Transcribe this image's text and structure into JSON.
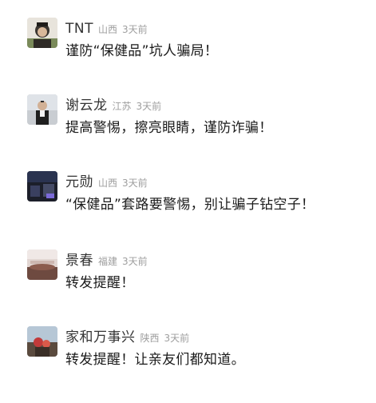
{
  "comments": [
    {
      "username": "TNT",
      "location": "山西",
      "time": "3天前",
      "text": "谨防“保健品”坑人骗局！",
      "avatar_icon": "user-avatar-icon"
    },
    {
      "username": "谢云龙",
      "location": "江苏",
      "time": "3天前",
      "text": "提高警惕，擦亮眼睛，谨防诈骗！",
      "avatar_icon": "user-avatar-icon"
    },
    {
      "username": "元勋",
      "location": "山西",
      "time": "3天前",
      "text": "“保健品”套路要警惕，别让骗子钻空子！",
      "avatar_icon": "user-avatar-icon"
    },
    {
      "username": "景春",
      "location": "福建",
      "time": "3天前",
      "text": "转发提醒！",
      "avatar_icon": "user-avatar-icon"
    },
    {
      "username": "家和万事兴",
      "location": "陕西",
      "time": "3天前",
      "text": "转发提醒！让亲友们都知道。",
      "avatar_icon": "user-avatar-icon"
    }
  ],
  "colors": {
    "username": "#333333",
    "meta": "#9e9e9e",
    "text": "#1a1a1a",
    "background": "#ffffff"
  }
}
